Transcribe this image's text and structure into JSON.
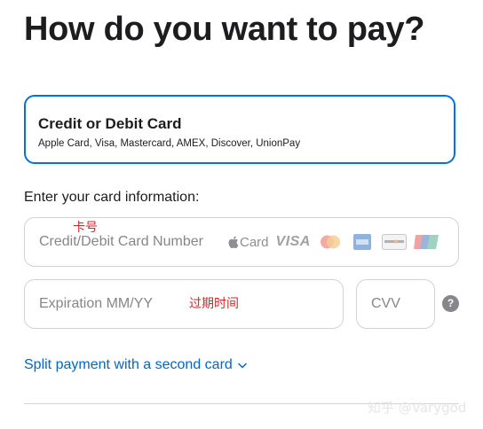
{
  "page": {
    "title": "How do you want to pay?"
  },
  "payment_option": {
    "title": "Credit or Debit Card",
    "subtitle": "Apple Card, Visa, Mastercard, AMEX, Discover, UnionPay",
    "selected": true
  },
  "card_info": {
    "label": "Enter your card information:",
    "card_number": {
      "placeholder": "Credit/Debit Card Number",
      "value": ""
    },
    "expiration": {
      "placeholder": "Expiration MM/YY",
      "value": ""
    },
    "cvv": {
      "placeholder": "CVV",
      "value": ""
    },
    "help_icon_text": "?"
  },
  "brand_logos": {
    "apple_card_text": "Card",
    "visa_text": "VISA",
    "icons": [
      "apple-card-logo",
      "visa-logo",
      "mastercard-logo",
      "amex-logo",
      "discover-logo",
      "unionpay-logo"
    ]
  },
  "annotations": {
    "card_number": "卡号",
    "expiration": "过期时间"
  },
  "split_payment": {
    "label": "Split payment with a second card",
    "icon": "chevron-down-icon"
  },
  "watermark": "知乎 @Varygod",
  "colors": {
    "accent": "#0071e3",
    "link": "#0066cc",
    "annotation": "#d0282a",
    "border": "#d2d2d7",
    "placeholder": "#86868b"
  }
}
